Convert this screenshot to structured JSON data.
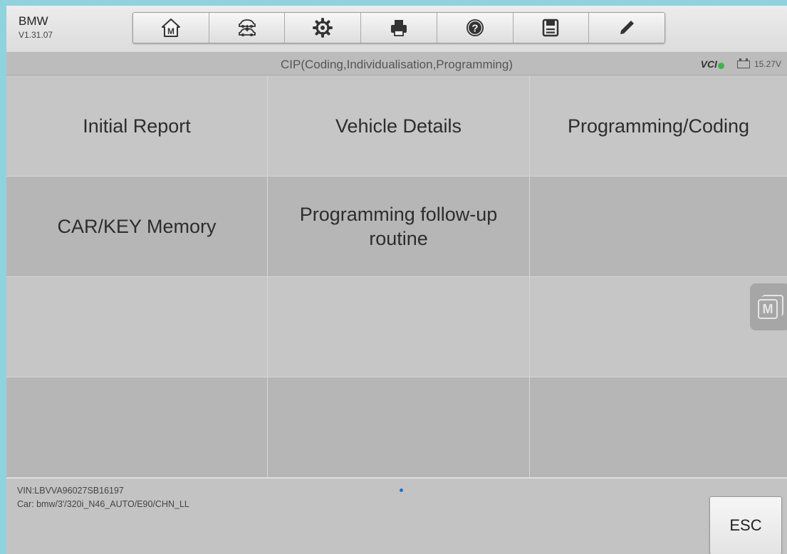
{
  "app": {
    "name": "BMW",
    "version": "V1.31.07"
  },
  "toolbar": {
    "buttons": [
      {
        "icon": "home-icon",
        "label": "M"
      },
      {
        "icon": "vehicle-swap-icon"
      },
      {
        "icon": "gear-icon"
      },
      {
        "icon": "print-icon"
      },
      {
        "icon": "help-icon"
      },
      {
        "icon": "save-icon"
      },
      {
        "icon": "pen-icon"
      }
    ]
  },
  "header": {
    "title": "CIP(Coding,Individualisation,Programming)"
  },
  "status": {
    "vci_label": "VCI",
    "voltage": "15.27V",
    "vci_color": "#3bb54a"
  },
  "menu": {
    "items": [
      "Initial Report",
      "Vehicle Details",
      "Programming/Coding",
      "CAR/KEY Memory",
      "Programming follow-up routine",
      "",
      "",
      "",
      "",
      "",
      "",
      ""
    ]
  },
  "floating": {
    "label": "M"
  },
  "footer": {
    "vin": "VIN:LBVVA96027SB16197",
    "car": "Car: bmw/3'/320i_N46_AUTO/E90/CHN_LL",
    "esc_label": "ESC"
  }
}
